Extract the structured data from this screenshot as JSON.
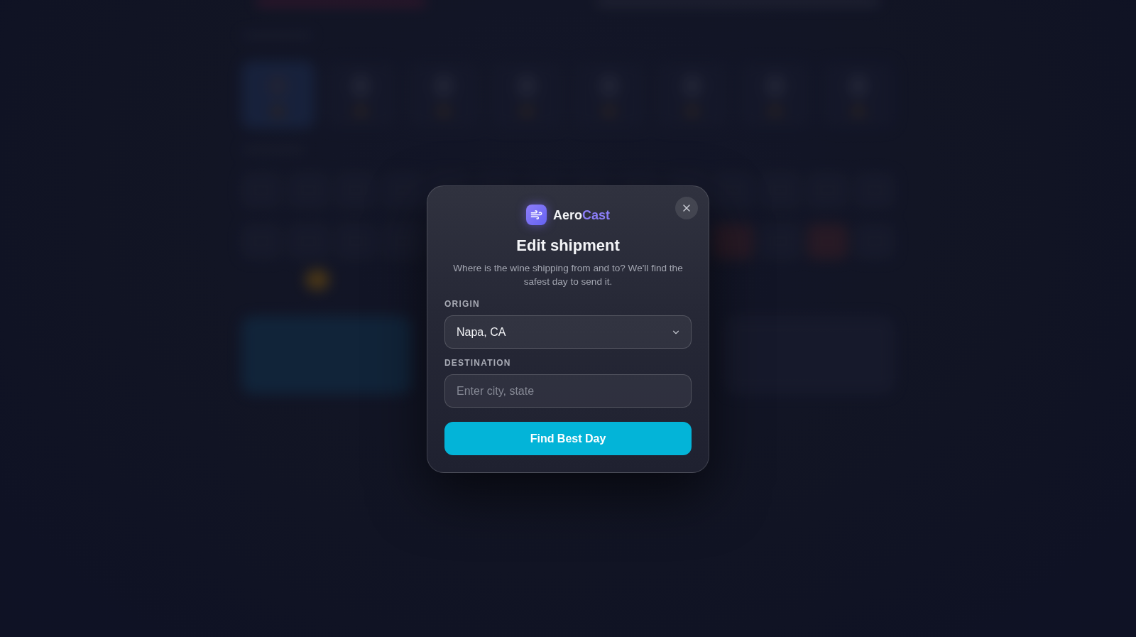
{
  "dialog": {
    "brand": {
      "parts": [
        {
          "text": "Aero",
          "kind": "plain"
        },
        {
          "text": "Cast",
          "kind": "accent"
        }
      ]
    },
    "title": "Edit shipment",
    "description": "Where is the wine shipping from and to? We'll find the safest day to send it.",
    "fields": [
      {
        "kind": "select",
        "label": "ORIGIN",
        "value": "Napa, CA"
      },
      {
        "kind": "text",
        "label": "DESTINATION",
        "placeholder": "Enter city, state"
      }
    ],
    "submit": "Find Best Day"
  }
}
